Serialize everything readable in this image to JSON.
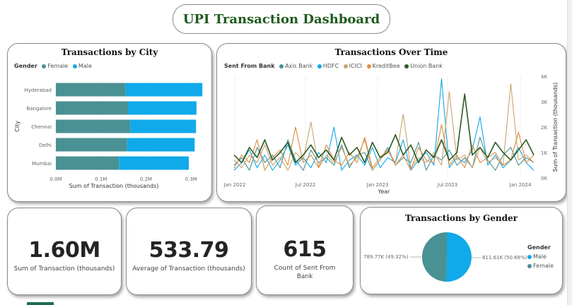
{
  "dashboard": {
    "title": "UPI Transaction Dashboard"
  },
  "colors": {
    "female": "#4a9194",
    "male": "#10a9ea",
    "axis": "#4a9194",
    "hdfc": "#10a9ea",
    "icici": "#c9a46e",
    "kreditbee": "#e08c3f",
    "union": "#2c5a23"
  },
  "city_chart": {
    "title": "Transactions by City",
    "legend_title": "Gender",
    "legend_items": [
      "Female",
      "Male"
    ],
    "ylabel": "City",
    "xlabel": "Sum of Transaction (thousands)",
    "ticks": [
      "0.0M",
      "0.1M",
      "0.2M",
      "0.3M"
    ]
  },
  "time_chart": {
    "title": "Transactions Over Time",
    "legend_title": "Sent From Bank",
    "legend_items": [
      "Axis Bank",
      "HDFC",
      "ICICI",
      "KreditBee",
      "Union Bank"
    ],
    "xlabel": "Year",
    "ylabel": "Sum of Transaction (thousands)",
    "x_ticks": [
      "Jan 2022",
      "Jul 2022",
      "Jan 2023",
      "Jul 2023",
      "Jan 2024"
    ],
    "y_ticks": [
      "0K",
      "1K",
      "2K",
      "3K",
      "4K"
    ]
  },
  "kpis": {
    "sum": {
      "value": "1.60M",
      "label": "Sum of Transaction (thousands)"
    },
    "avg": {
      "value": "533.79",
      "label": "Average of Transaction (thousands)"
    },
    "count": {
      "value": "615",
      "label": "Count of Sent From Bank"
    }
  },
  "gender_chart": {
    "title": "Transactions by Gender",
    "legend_title": "Gender",
    "legend_items": [
      "Male",
      "Female"
    ],
    "label_female": "789.77K (49.32%)",
    "label_male": "811.61K (50.68%)"
  },
  "chart_data": [
    {
      "type": "bar",
      "title": "Transactions by City",
      "orientation": "horizontal",
      "stacked": true,
      "categories": [
        "Hyderabad",
        "Bangalore",
        "Chennai",
        "Delhi",
        "Mumbai"
      ],
      "series": [
        {
          "name": "Female",
          "values": [
            155,
            160,
            165,
            158,
            140
          ]
        },
        {
          "name": "Male",
          "values": [
            170,
            152,
            146,
            150,
            155
          ]
        }
      ],
      "xlabel": "Sum of Transaction (thousands)",
      "ylabel": "City",
      "xlim": [
        0,
        320
      ]
    },
    {
      "type": "line",
      "title": "Transactions Over Time",
      "xlabel": "Year",
      "ylabel": "Sum of Transaction (thousands)",
      "ylim": [
        0,
        4000
      ],
      "x_range": [
        "Jan 2022",
        "Mar 2024"
      ],
      "series": [
        {
          "name": "Axis Bank",
          "values": [
            500,
            800,
            300,
            1200,
            600,
            900,
            400,
            1500,
            700,
            300,
            1100,
            600,
            800,
            500,
            1300,
            400,
            900,
            1000,
            300,
            700,
            1200,
            500,
            800,
            600,
            1400,
            300,
            900,
            700,
            1100,
            500,
            800,
            400,
            1600,
            700,
            300,
            900,
            1200,
            500,
            800,
            600
          ]
        },
        {
          "name": "HDFC",
          "values": [
            300,
            600,
            1100,
            400,
            900,
            300,
            700,
            1300,
            500,
            800,
            400,
            1000,
            600,
            2000,
            300,
            700,
            900,
            500,
            1200,
            400,
            800,
            600,
            1500,
            300,
            700,
            1000,
            500,
            3900,
            400,
            800,
            600,
            1100,
            2400,
            500,
            900,
            400,
            700,
            1200,
            600,
            300
          ]
        },
        {
          "name": "ICICI",
          "values": [
            700,
            400,
            900,
            600,
            1300,
            500,
            800,
            300,
            1000,
            700,
            2200,
            400,
            900,
            600,
            1200,
            500,
            800,
            1500,
            300,
            700,
            1100,
            600,
            2500,
            400,
            800,
            600,
            1000,
            500,
            3400,
            700,
            900,
            400,
            1200,
            600,
            800,
            500,
            3700,
            700,
            900,
            600
          ]
        },
        {
          "name": "KreditBee",
          "values": [
            400,
            900,
            600,
            1500,
            300,
            800,
            1100,
            500,
            2000,
            600,
            900,
            400,
            1300,
            700,
            500,
            1000,
            600,
            1600,
            400,
            800,
            1100,
            500,
            900,
            300,
            1200,
            700,
            600,
            2100,
            500,
            900,
            400,
            1300,
            600,
            800,
            1000,
            500,
            700,
            1800,
            600,
            900
          ]
        },
        {
          "name": "Union Bank",
          "values": [
            900,
            600,
            1200,
            800,
            1500,
            700,
            1000,
            1400,
            600,
            900,
            1300,
            800,
            1100,
            700,
            1600,
            900,
            1200,
            600,
            1400,
            800,
            1000,
            1700,
            900,
            1300,
            600,
            1100,
            800,
            1500,
            700,
            1000,
            3300,
            900,
            1200,
            800,
            1400,
            1000,
            700,
            1100,
            1500,
            900
          ]
        }
      ]
    },
    {
      "type": "pie",
      "title": "Transactions by Gender",
      "categories": [
        "Male",
        "Female"
      ],
      "values": [
        811.61,
        789.77
      ],
      "labels": [
        "811.61K (50.68%)",
        "789.77K (49.32%)"
      ]
    }
  ]
}
